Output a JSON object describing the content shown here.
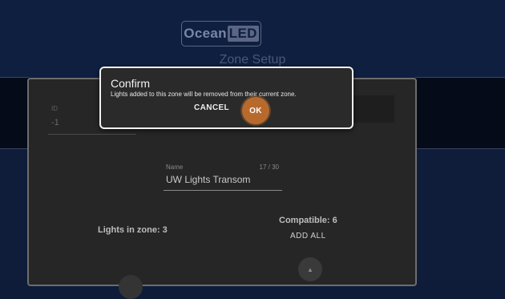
{
  "header": {
    "logo_main": "Ocean",
    "logo_accent": "LED",
    "page_title": "Zone Setup"
  },
  "zone_form": {
    "id_label": "ID",
    "id_value": "-1",
    "name_label": "Name",
    "name_counter": "17 / 30",
    "name_value": "UW Lights Transom",
    "lights_in_zone": "Lights in zone: 3",
    "compatible": "Compatible: 6",
    "add_all_label": "ADD ALL",
    "scroll_up_icon": "▲"
  },
  "dialog": {
    "title": "Confirm",
    "message": "Lights added to this zone will be removed from their current zone.",
    "cancel_label": "CANCEL",
    "ok_label": "OK"
  },
  "colors": {
    "app_background": "#0f1d3b",
    "card_background": "#262626",
    "dialog_background": "#2a2a2a",
    "ok_accent": "#b86a2d"
  }
}
